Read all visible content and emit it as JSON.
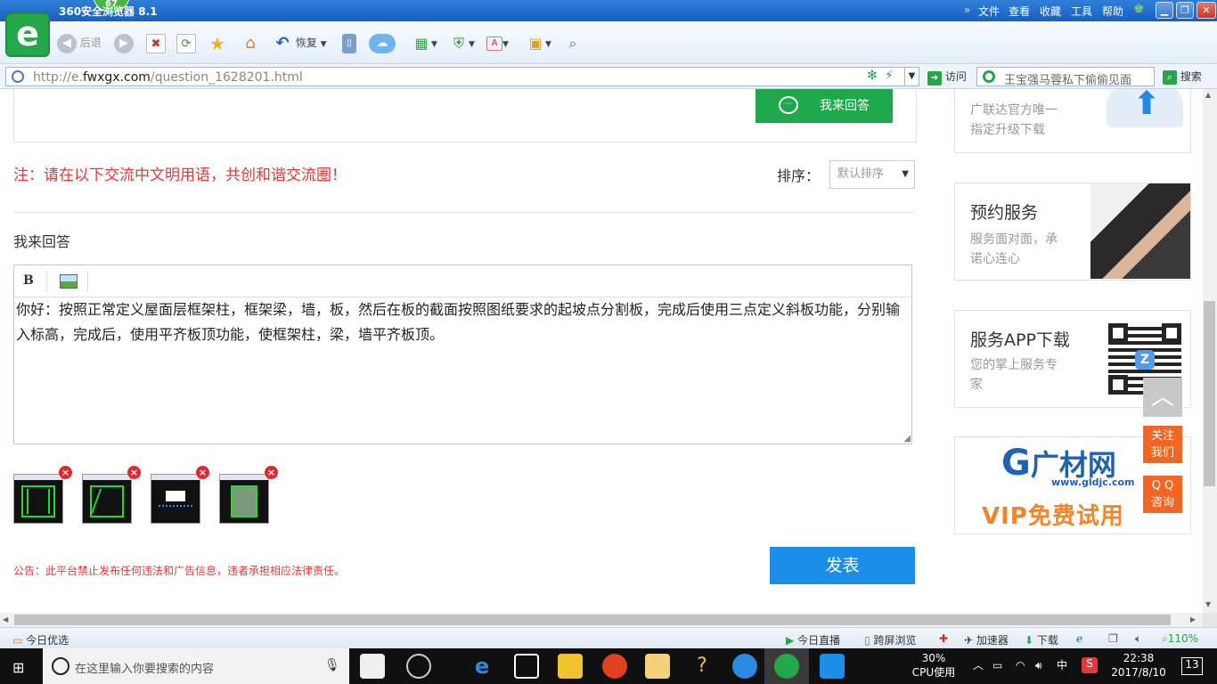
{
  "window": {
    "title": "360安全浏览器 8.1",
    "badge": "67",
    "menu": [
      "文件",
      "查看",
      "收藏",
      "工具",
      "帮助"
    ]
  },
  "toolbar": {
    "back_label": "后退",
    "restore_label": "恢复"
  },
  "address": {
    "url_prefix": "http://e.",
    "url_domain": "fwxgx.com",
    "url_path": "/question_1628201.html",
    "visit_label": "访问",
    "search_placeholder": "王宝强马蓉私下偷偷见面",
    "search_label": "搜索"
  },
  "page": {
    "reply_top_label": "我来回答",
    "notice": "注：请在以下交流中文明用语，共创和谐交流圈！",
    "sort_label": "排序：",
    "sort_value": "默认排序",
    "my_reply_label": "我来回答",
    "editor_bold": "B",
    "editor_content": "你好：按照正常定义屋面层框架柱，框架梁，墙，板，然后在板的截面按照图纸要求的起坡点分割板，完成后使用三点定义斜板功能，分别输入标高，完成后，使用平齐板顶功能，使框架柱，梁，墙平齐板顶。",
    "thumb_delete": "×",
    "announcement": "公告：此平台禁止发布任何违法和广告信息，违者承担相应法律责任。",
    "publish_label": "发表"
  },
  "sidebar": {
    "upgrade_line1": "广联达官方唯一",
    "upgrade_line2": "指定升级下载",
    "booking_title": "预约服务",
    "booking_line1": "服务面对面，承",
    "booking_line2": "诺心连心",
    "app_title": "服务APP下载",
    "app_line1": "您的掌上服务专",
    "app_line2": "家",
    "ad_brand": "广材网",
    "ad_site": "www.gldjc.com",
    "ad_vip": "VIP免费试用",
    "follow_line1": "关注",
    "follow_line2": "我们",
    "qq_line1": "Q Q",
    "qq_line2": "咨询"
  },
  "statusbar": {
    "today_pick": "今日优选",
    "today_live": "今日直播",
    "cross_screen": "跨屏浏览",
    "accelerator": "加速器",
    "download": "下载",
    "zoom": "110%"
  },
  "taskbar": {
    "search_placeholder": "在这里输入你要搜索的内容",
    "cpu_percent": "30%",
    "cpu_label": "CPU使用",
    "ime": "中",
    "time": "22:38",
    "date": "2017/8/10",
    "notifications": "13"
  },
  "colors": {
    "accent_green": "#1ea84c",
    "publish_blue": "#1c8de8",
    "notice_red": "#e03a3a",
    "float_orange": "#f26522"
  }
}
